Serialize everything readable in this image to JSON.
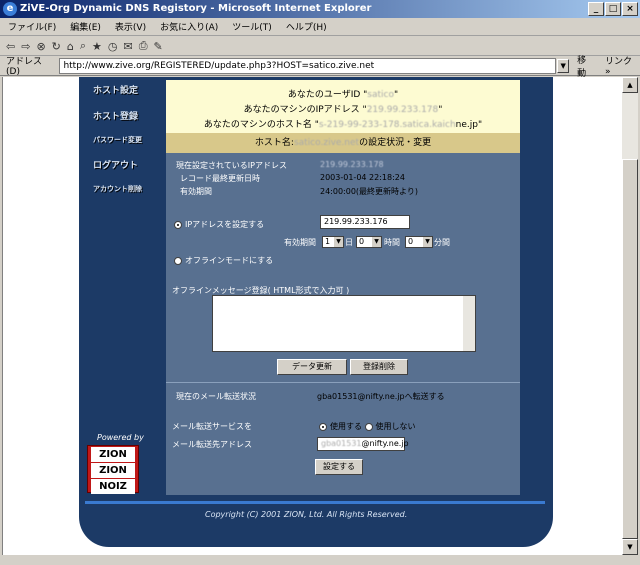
{
  "window": {
    "title": "ZiVE-Org Dynamic DNS Registory - Microsoft Internet Explorer"
  },
  "menu": [
    "ファイル(F)",
    "編集(E)",
    "表示(V)",
    "お気に入り(A)",
    "ツール(T)",
    "ヘルプ(H)"
  ],
  "address": {
    "label": "アドレス(D)",
    "url": "http://www.zive.org/REGISTERED/update.php3?HOST=satico.zive.net",
    "go": "移動",
    "links": "リンク »"
  },
  "nav": [
    "ホスト設定",
    "ホスト登録",
    "パスワード変更",
    "ログアウト",
    "アカウント削除"
  ],
  "powered": "Powered by",
  "logo": {
    "top": "ZION",
    "mid": "ZION",
    "bot": "NOIZ"
  },
  "info": {
    "line1_prefix": "あなたのユーザID \"",
    "user": "satico",
    "line2_prefix": "あなたのマシンのIPアドレス \"",
    "ip": "219.99.233.178",
    "line3_prefix": "あなたのマシンのホスト名 \"",
    "host": "s-219-99-233-178.satica.kaich",
    "host_suffix": "ne.jp\"",
    "close": "\""
  },
  "hosthead": {
    "prefix": "ホスト名:",
    "host": "satico.zive.net",
    "suffix": "の設定状況・変更"
  },
  "status": {
    "current_ip_label": "現在設定されているIPアドレス",
    "current_ip": "219.99.233.178",
    "last_update_label": "レコード最終更新日時",
    "last_update": "2003-01-04 22:18:24",
    "ttl_label": "有効期間",
    "ttl": "24:00:00(最終更新時より)"
  },
  "set_ip": {
    "label": "IPアドレスを設定する",
    "value": "219.99.233.176",
    "expire_label": "有効期間",
    "day_val": "1",
    "day_unit": "日",
    "hour_val": "0",
    "hour_unit": "時間",
    "min_val": "0",
    "min_unit": "分間"
  },
  "offline": {
    "label": "オフラインモードにする",
    "msg_label": "オフラインメッセージ登録( HTML形式で入力可 )"
  },
  "buttons": {
    "update": "データ更新",
    "delete": "登録削除",
    "set": "設定する"
  },
  "mail": {
    "status_label": "現在のメール転送状況",
    "status": "gba01531@nifty.ne.jpへ転送する",
    "service_label": "メール転送サービスを",
    "use": "使用する",
    "nouse": "使用しない",
    "addr_label": "メール転送先アドレス",
    "addr_prefix": "gba01531",
    "addr_suffix": "@nifty.ne.jp"
  },
  "copyright": "Copyright (C) 2001 ZION, Ltd. All Rights Reserved."
}
